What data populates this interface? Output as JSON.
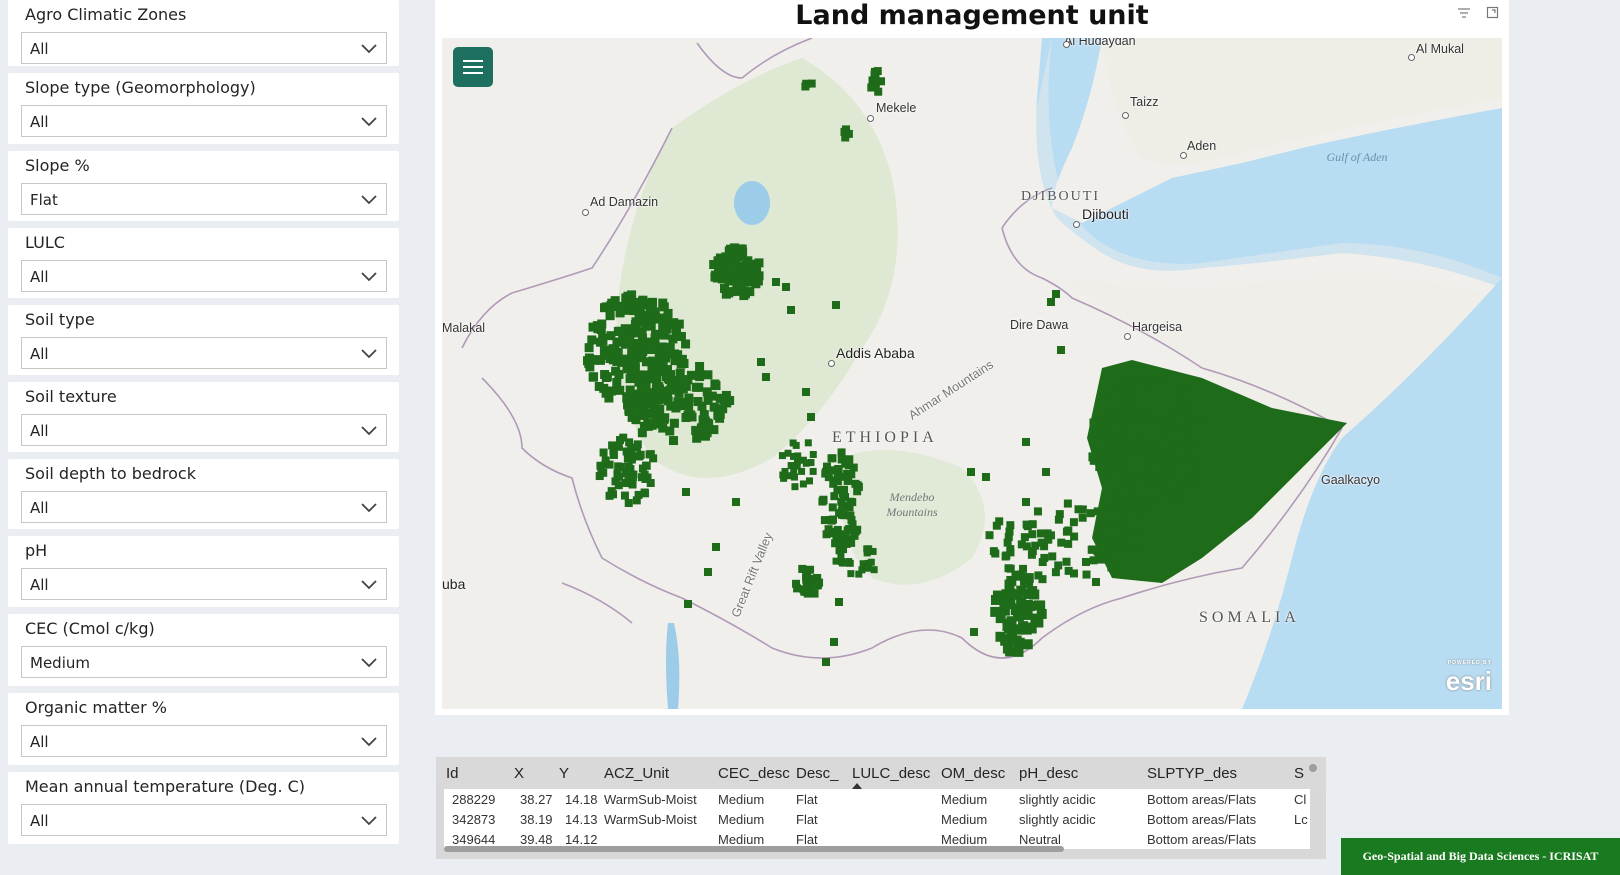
{
  "filters": [
    {
      "title": "Agro Climatic Zones",
      "value": "All"
    },
    {
      "title": "Slope type (Geomorphology)",
      "value": "All"
    },
    {
      "title": "Slope %",
      "value": "Flat"
    },
    {
      "title": "LULC",
      "value": "All"
    },
    {
      "title": "Soil type",
      "value": "All"
    },
    {
      "title": "Soil texture",
      "value": "All"
    },
    {
      "title": "Soil depth to bedrock",
      "value": "All"
    },
    {
      "title": "pH",
      "value": "All"
    },
    {
      "title": "CEC (Cmol c/kg)",
      "value": "Medium"
    },
    {
      "title": "Organic matter %",
      "value": "All"
    },
    {
      "title": "Mean annual temperature (Deg. C)",
      "value": "All"
    }
  ],
  "map": {
    "title": "Land management unit",
    "marker_color": "#1e6b1a",
    "places": {
      "hudaydah": "Al Hudaydah",
      "mukalla": "Al Mukal",
      "taizz": "Taizz",
      "aden": "Aden",
      "mekele": "Mekele",
      "ad_damazin": "Ad Damazin",
      "djibouti_city": "Djibouti",
      "malakal": "Malakal",
      "dire_dawa": "Dire Dawa",
      "hargeisa": "Hargeisa",
      "addis_ababa": "Addis Ababa",
      "gaalkacyo": "Gaalkacyo",
      "juba": "uba"
    },
    "countries": {
      "djibouti": "DJIBOUTI",
      "ethiopia": "ETHIOPIA",
      "somalia": "SOMALIA"
    },
    "features": {
      "gulf": "Gulf of Aden",
      "ahmar": "Ahmar Mountains",
      "mendebo": "Mendebo Mountains",
      "rift": "Great Rift Valley"
    },
    "esri": "esri",
    "esri_powered": "POWERED BY"
  },
  "table": {
    "columns": [
      "Id",
      "X",
      "Y",
      "ACZ_Unit",
      "CEC_desc",
      "Desc_",
      "LULC_desc",
      "OM_desc",
      "pH_desc",
      "SLPTYP_des",
      "S"
    ],
    "rows": [
      [
        "288229",
        "38.27",
        "14.18",
        "WarmSub-Moist",
        "Medium",
        "Flat",
        "",
        "Medium",
        "slightly acidic",
        "Bottom areas/Flats",
        "Cl"
      ],
      [
        "342873",
        "38.19",
        "14.13",
        "WarmSub-Moist",
        "Medium",
        "Flat",
        "",
        "Medium",
        "slightly acidic",
        "Bottom areas/Flats",
        "Lc"
      ],
      [
        "349644",
        "39.48",
        "14.12",
        "",
        "Medium",
        "Flat",
        "",
        "Medium",
        "Neutral",
        "Bottom areas/Flats",
        ""
      ]
    ]
  },
  "footer": {
    "badge": "Geo-Spatial and Big Data Sciences - ICRISAT"
  }
}
